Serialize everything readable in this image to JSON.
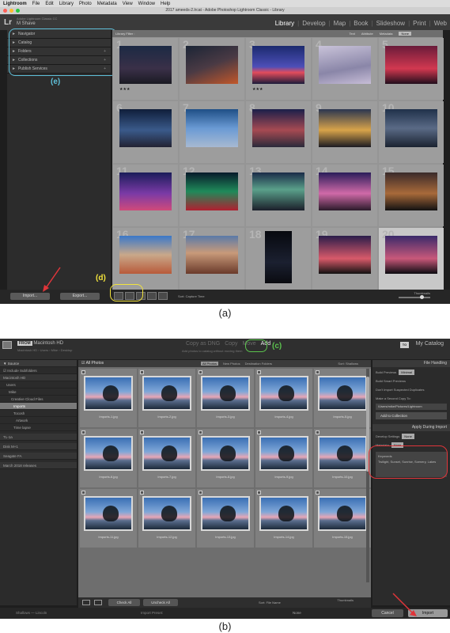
{
  "a": {
    "menubar": [
      "Lightroom",
      "File",
      "Edit",
      "Library",
      "Photo",
      "Metadata",
      "View",
      "Window",
      "Help"
    ],
    "window_title": "2017 ameeds-2.lrcat - Adobe Photoshop Lightroom Classic - Library",
    "identity": {
      "logo": "Lr",
      "catalog": "Adobe Lightroom Classic CC",
      "user": "M Shave"
    },
    "modules": [
      "Library",
      "Develop",
      "Map",
      "Book",
      "Slideshow",
      "Print",
      "Web"
    ],
    "panels": [
      {
        "label": "Navigator"
      },
      {
        "label": "Catalog"
      },
      {
        "label": "Folders"
      },
      {
        "label": "Collections"
      },
      {
        "label": "Publish Services"
      }
    ],
    "filter_bar": {
      "label": "Library Filter :",
      "options": [
        "Text",
        "Attribute",
        "Metadata",
        "None"
      ],
      "active": "None"
    },
    "grid_numbers": [
      "1",
      "2",
      "3",
      "4",
      "5",
      "6",
      "7",
      "8",
      "9",
      "10",
      "11",
      "12",
      "13",
      "14",
      "15",
      "16",
      "17",
      "18",
      "19",
      "20"
    ],
    "toolbar": {
      "import_label": "Import...",
      "export_label": "Export...",
      "sort_label": "Sort:",
      "sort_value": "Capture Time",
      "thumbnails_label": "Thumbnails"
    },
    "annotations": {
      "e": "(e)",
      "d": "(d)"
    },
    "caption": "(a)"
  },
  "b": {
    "from": {
      "badge": "FROM",
      "volume": "Macintosh HD",
      "path": "Macintosh HD › Users › Mike › Desktop"
    },
    "modes": [
      "Copy as DNG",
      "Copy",
      "Move",
      "Add"
    ],
    "mode_hint": "Add photos to catalog without moving them",
    "to": {
      "badge": "TO",
      "label": "My Catalog"
    },
    "annotation_c": "(c)",
    "source": {
      "header": "Source",
      "include_subfolders": "Include Subfolders",
      "rows": [
        "Macintosh HD",
        "Users",
        "Mike",
        "Creative Cloud Files",
        "Imports",
        "Tocosh",
        "Artwork",
        "Time lapse"
      ],
      "volumes": [
        "TL-1a",
        "Disk M+1",
        "Seagate FA",
        "March 2018 releases"
      ]
    },
    "center": {
      "all_photos": "All Photos",
      "tabs": [
        "All Photos",
        "New Photos",
        "Destination Folders"
      ],
      "sort_label": "Sort:",
      "sort_value": "Shallows",
      "filenames": [
        "Imports-1.jpg",
        "Imports-2.jpg",
        "Imports-3.jpg",
        "Imports-4.jpg",
        "Imports-5.jpg",
        "Imports-6.jpg",
        "Imports-7.jpg",
        "Imports-8.jpg",
        "Imports-9.jpg",
        "Imports-10.jpg",
        "Imports-11.jpg",
        "Imports-12.jpg",
        "Imports-13.jpg",
        "Imports-14.jpg",
        "Imports-15.jpg"
      ],
      "check_all": "Check All",
      "uncheck_all": "Uncheck All",
      "bottom_sort": "Sort:",
      "bottom_sort_value": "File Name",
      "thumbnails_label": "Thumbnails"
    },
    "right": {
      "file_handling": "File Handling",
      "build_previews_label": "Build Previews",
      "build_previews_value": "Minimal",
      "smart_previews": "Build Smart Previews",
      "dont_import": "Don't Import Suspected Duplicates",
      "second_copy": "Make a Second Copy To:",
      "second_copy_path": "/Users/mike/Pictures/Lightroom",
      "add_collection": "Add to Collection",
      "apply_during": "Apply During Import",
      "develop_label": "Develop Settings",
      "develop_value": "None",
      "metadata_label": "Metadata",
      "metadata_value": "None",
      "keywords_label": "Keywords",
      "keywords_value": "Twilight, Sunset, Sunrise, Scenery, Lakes"
    },
    "status": {
      "left": "Shallows — Lincoln",
      "preset": "Import Preset:",
      "preset_value": "None",
      "cancel": "Cancel",
      "import": "Import"
    },
    "caption": "(b)"
  },
  "colors": {
    "cyan": "#5fc0d9",
    "yellow": "#f2e33c",
    "green": "#5bc24d",
    "red": "#e0353a"
  }
}
